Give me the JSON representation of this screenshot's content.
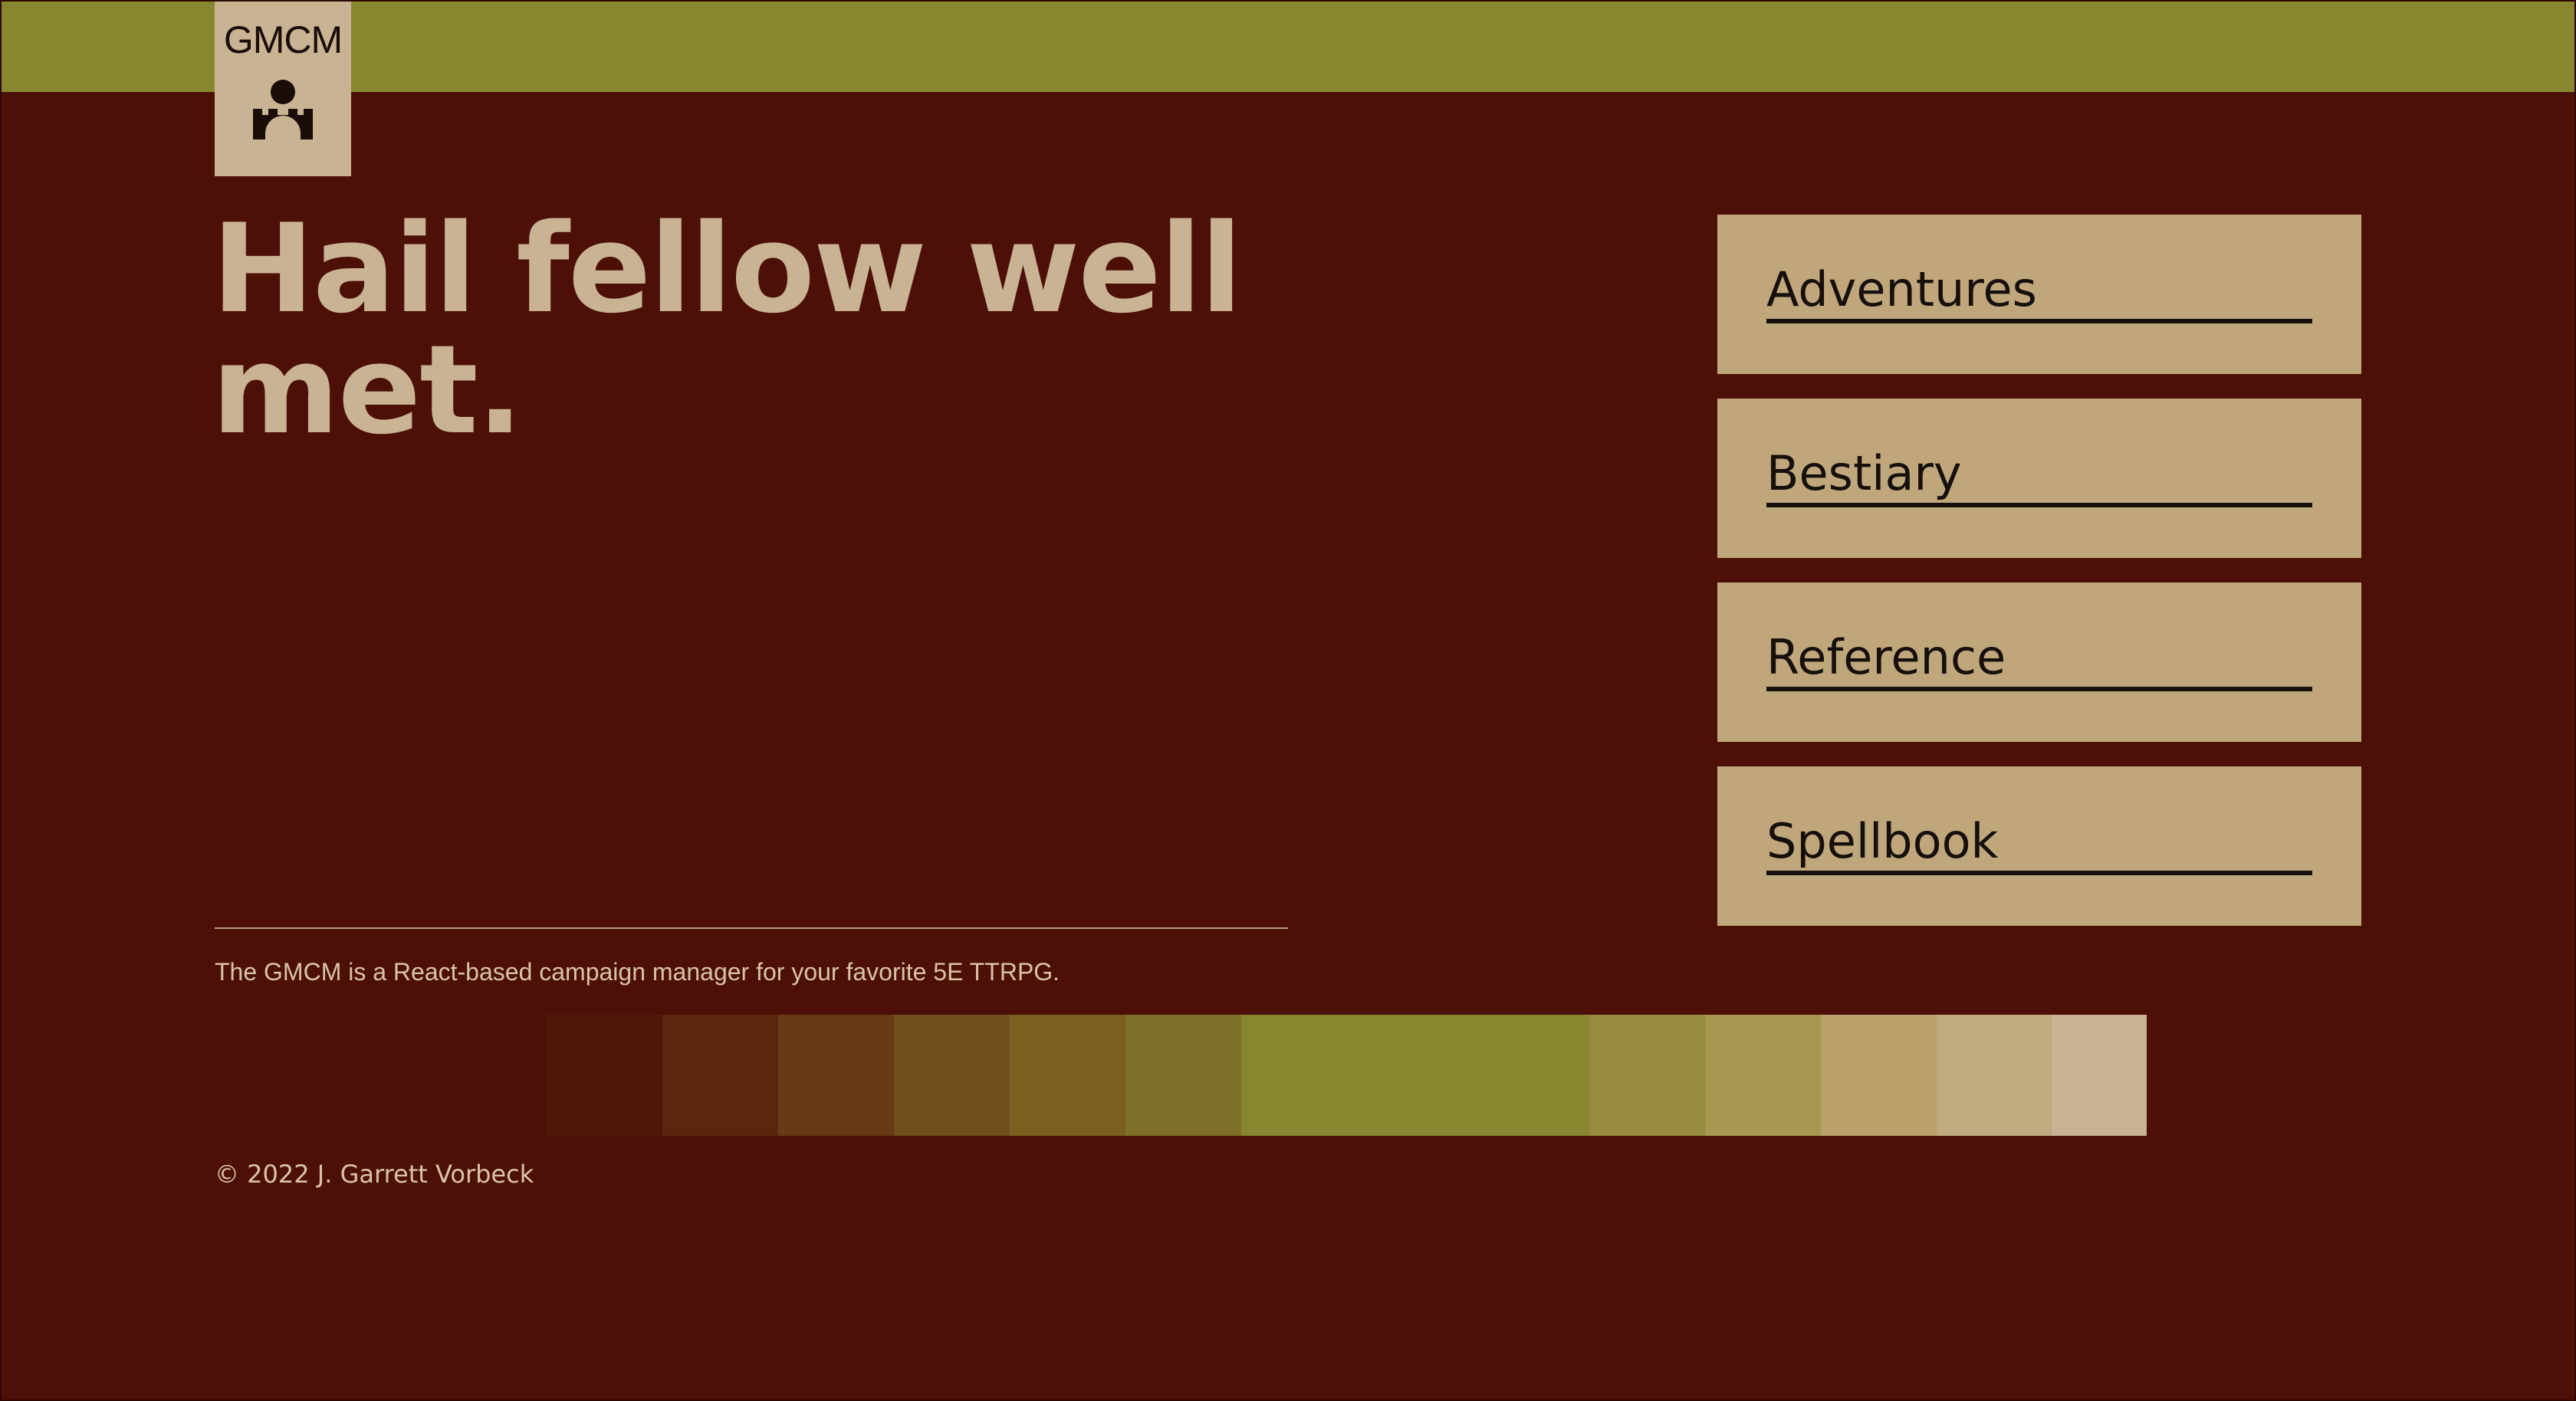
{
  "header": {
    "logo_text": "GMCM",
    "logo_icon": "castle-gate-icon",
    "bar_color": "#87872f"
  },
  "main": {
    "headline": "Hail fellow well met.",
    "nav": [
      {
        "label": "Adventures"
      },
      {
        "label": "Bestiary"
      },
      {
        "label": "Reference"
      },
      {
        "label": "Spellbook"
      }
    ]
  },
  "footer": {
    "description": "The GMCM is a React-based campaign manager for your favorite 5E TTRPG.",
    "palette": [
      "#4f1708",
      "#5a260e",
      "#663a14",
      "#724e1c",
      "#7a5f20",
      "#7e7026",
      "#87872f",
      "#968b3f",
      "#a7974f",
      "#b8a269",
      "#c2aa80",
      "#c9b393"
    ],
    "copyright": "© 2022 J. Garrett Vorbeck"
  },
  "colors": {
    "background": "#4d1007",
    "accent": "#87872f",
    "card": "#bfa77b",
    "text_light": "#c9b393"
  }
}
